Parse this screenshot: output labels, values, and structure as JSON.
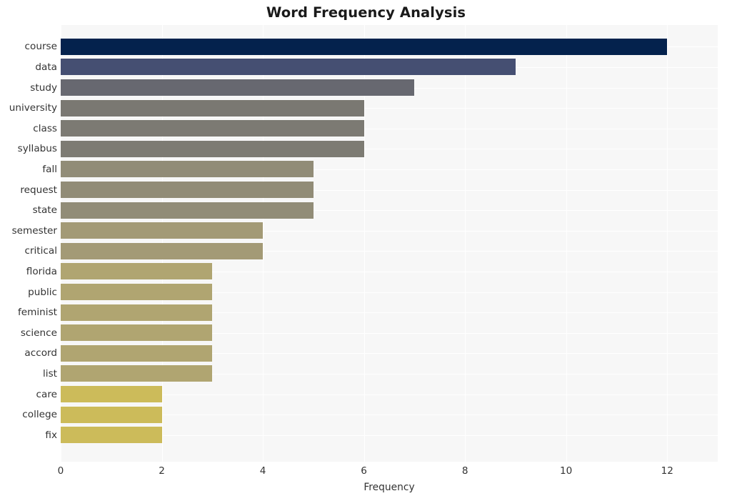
{
  "chart_data": {
    "type": "bar",
    "orientation": "horizontal",
    "title": "Word Frequency Analysis",
    "xlabel": "Frequency",
    "ylabel": "",
    "xlim": [
      0,
      13
    ],
    "xticks": [
      0,
      2,
      4,
      6,
      8,
      10,
      12
    ],
    "xtick_labels": [
      "0",
      "2",
      "4",
      "6",
      "8",
      "10",
      "12"
    ],
    "grid": true,
    "grid_color": "#ffffff",
    "plot_background": "#f7f7f7",
    "figure_background": "#ffffff",
    "legend": null,
    "categories": [
      "course",
      "data",
      "study",
      "university",
      "class",
      "syllabus",
      "fall",
      "request",
      "state",
      "semester",
      "critical",
      "florida",
      "public",
      "feminist",
      "science",
      "accord",
      "list",
      "care",
      "college",
      "fix"
    ],
    "values": [
      12,
      9,
      7,
      6,
      6,
      6,
      5,
      5,
      5,
      4,
      4,
      3,
      3,
      3,
      3,
      3,
      3,
      2,
      2,
      2
    ],
    "bar_colors": [
      "#04224d",
      "#454f72",
      "#676870",
      "#7a7872",
      "#7c7a73",
      "#7d7b73",
      "#918c77",
      "#918c77",
      "#918c77",
      "#a39a76",
      "#a39a76",
      "#b0a571",
      "#b0a571",
      "#b0a571",
      "#b0a571",
      "#b0a571",
      "#b0a571",
      "#ccbb5a",
      "#ccbb5a",
      "#ccbb5a"
    ],
    "colormap": "cividis_r"
  }
}
